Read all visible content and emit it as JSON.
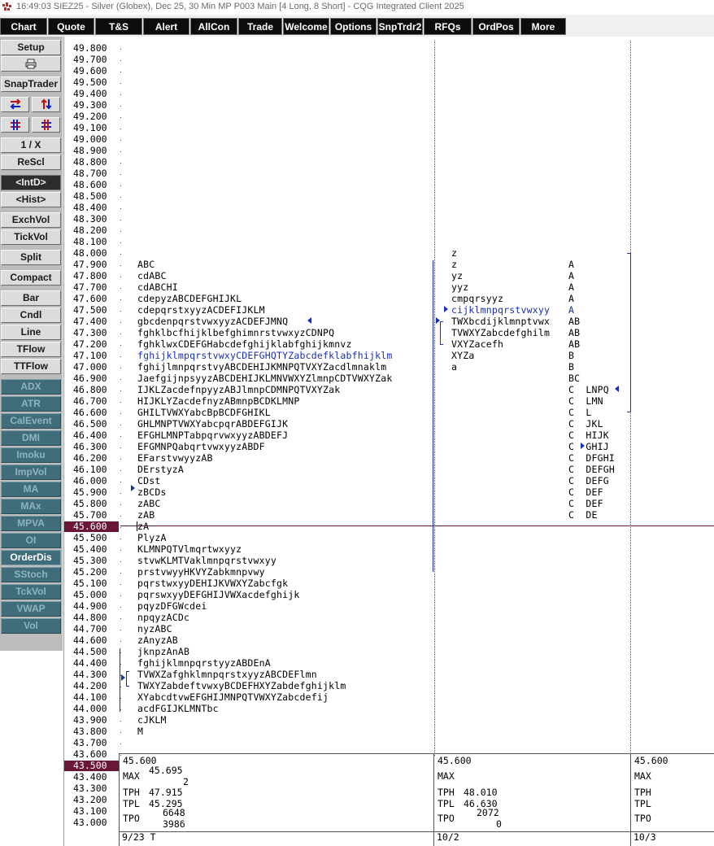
{
  "window": {
    "title": "16:49:03   SIEZ25 - Silver (Globex), Dec 25, 30 Min MP   P003 Main   [4 Long, 8 Short] - CQG Integrated Client 2025"
  },
  "menu": [
    "Chart",
    "Quote",
    "T&S",
    "Alert",
    "AllCon",
    "Trade",
    "Welcome",
    "Options",
    "SnpTrdr2",
    "RFQs",
    "OrdPos",
    "More"
  ],
  "sidebar": {
    "setup": "Setup",
    "print_icon": "printer-icon",
    "snaptrader": "SnapTrader",
    "one_x": "1 / X",
    "rescl": "ReScl",
    "intd": "<IntD>",
    "hist": "<Hist>",
    "exchvol": "ExchVol",
    "tickvol": "TickVol",
    "split": "Split",
    "compact": "Compact",
    "bar": "Bar",
    "cndl": "Cndl",
    "line": "Line",
    "tflow": "TFlow",
    "ttflow": "TTFlow",
    "studies": [
      "ADX",
      "ATR",
      "CalEvent",
      "DMI",
      "Imoku",
      "ImpVol",
      "MA",
      "MAx",
      "MPVA",
      "OI",
      "OrderDis",
      "SStoch",
      "TckVol",
      "VWAP",
      "Vol"
    ],
    "active_study": "OrderDis"
  },
  "price_axis": {
    "labels": [
      "49.800",
      "49.700",
      "49.600",
      "49.500",
      "49.400",
      "49.300",
      "49.200",
      "49.100",
      "49.000",
      "48.900",
      "48.800",
      "48.700",
      "48.600",
      "48.500",
      "48.400",
      "48.300",
      "48.200",
      "48.100",
      "48.000",
      "47.900",
      "47.800",
      "47.700",
      "47.600",
      "47.500",
      "47.400",
      "47.300",
      "47.200",
      "47.100",
      "47.000",
      "46.900",
      "46.800",
      "46.700",
      "46.600",
      "46.500",
      "46.400",
      "46.300",
      "46.200",
      "46.100",
      "46.000",
      "45.900",
      "45.800",
      "45.700",
      "45.600",
      "45.500",
      "45.400",
      "45.300",
      "45.200",
      "45.100",
      "45.000",
      "44.900",
      "44.800",
      "44.700",
      "44.600",
      "44.500",
      "44.400",
      "44.300",
      "44.200",
      "44.100",
      "44.000",
      "43.900",
      "43.800",
      "43.700",
      "43.600",
      "43.500",
      "43.400",
      "43.300",
      "43.200",
      "43.100",
      "43.000"
    ],
    "current_price": "45.600",
    "highlight_bottom": "43.500",
    "highlight_color": "#6b1537"
  },
  "profile1": {
    "rows": [
      {
        "price": "47.900",
        "text": "ABC"
      },
      {
        "price": "47.800",
        "text": "cdABC"
      },
      {
        "price": "47.700",
        "text": "cdABCHI"
      },
      {
        "price": "47.600",
        "text": "cdepyzABCDEFGHIJKL"
      },
      {
        "price": "47.500",
        "text": "cdepqrstxyyzACDEFIJKLM"
      },
      {
        "price": "47.400",
        "text": "gbcdenpqrstvwxyyzACDEFJMNQ"
      },
      {
        "price": "47.300",
        "text": "fghklbcfhijklbefghimnrstvwxyzCDNPQ"
      },
      {
        "price": "47.200",
        "text": "fghklwxCDEFGHabcdefghijklabfghijkmnvz"
      },
      {
        "price": "47.100",
        "text": "fghijklmpqrstvwxyCDEFGHQTYZabcdefklabfhijklm",
        "blue": true
      },
      {
        "price": "47.000",
        "text": "fghijlmnpqrstvyABCDEHIJKMNPQTVXYZacdlmnaklm"
      },
      {
        "price": "46.900",
        "text": "JaefgijnpsyyzABCDEHIJKLMNVWXYZlmnpCDTVWXYZak"
      },
      {
        "price": "46.800",
        "text": "IJKLZacdefnpyyzABJlmnpCDMNPQTVXYZak"
      },
      {
        "price": "46.700",
        "text": "HIJKLYZacdefnyzABmnpBCDKLMNP"
      },
      {
        "price": "46.600",
        "text": "GHILTVWXYabcBpBCDFGHIKL"
      },
      {
        "price": "46.500",
        "text": "GHLMNPTVWXYabcpqrABDEFGIJK"
      },
      {
        "price": "46.400",
        "text": "EFGHLMNPTabpqrvwxyyzABDEFJ"
      },
      {
        "price": "46.300",
        "text": "EFGMNPQabqrtvwxyyzABDF"
      },
      {
        "price": "46.200",
        "text": "EFarstvwyyzAB"
      },
      {
        "price": "46.100",
        "text": "DErstyzA"
      },
      {
        "price": "46.000",
        "text": "CDst"
      },
      {
        "price": "45.900",
        "text": "zBCDs"
      },
      {
        "price": "45.800",
        "text": "zABC"
      },
      {
        "price": "45.700",
        "text": "zAB"
      },
      {
        "price": "45.600",
        "text": "zA"
      },
      {
        "price": "45.500",
        "text": "PlyzA"
      },
      {
        "price": "45.400",
        "text": "KLMNPQTVlmqrtwxyyz"
      },
      {
        "price": "45.300",
        "text": "stvwKLMTVaklmnpqrstvwxyy"
      },
      {
        "price": "45.200",
        "text": "prstvwyyHKVYZabkmnpvwy"
      },
      {
        "price": "45.100",
        "text": "pqrstwxyyDEHIJKVWXYZabcfgk"
      },
      {
        "price": "45.000",
        "text": "pqrswxyyDEFGHIJVWXacdefghijk"
      },
      {
        "price": "44.900",
        "text": "pqyzDFGWcdei"
      },
      {
        "price": "44.800",
        "text": "npqyzACDc"
      },
      {
        "price": "44.700",
        "text": "nyzABC"
      },
      {
        "price": "44.600",
        "text": "zAnyzAB"
      },
      {
        "price": "44.500",
        "text": "jknpzAnAB"
      },
      {
        "price": "44.400",
        "text": "fghijklmnpqrstyyzABDEnA"
      },
      {
        "price": "44.300",
        "text": "TVWXZafghklmnpqrstxyyzABCDEFlmn"
      },
      {
        "price": "44.200",
        "text": "TWXYZabdeftvwxyBCDEFHXYZabdefghijklm"
      },
      {
        "price": "44.100",
        "text": "XYabcdtvwEFGHIJMNPQTVWXYZabcdefij"
      },
      {
        "price": "44.000",
        "text": "acdFGIJKLMNTbc"
      },
      {
        "price": "43.900",
        "text": "cJKLM"
      },
      {
        "price": "43.800",
        "text": "M"
      }
    ],
    "stats": {
      "price": "45.600",
      "max_label": "MAX",
      "max_val": "45.695",
      "max_count": "2",
      "tph_label": "TPH",
      "tph": "47.915",
      "tpl_label": "TPL",
      "tpl": "45.295",
      "tpo_label": "TPO",
      "tpo1": "6648",
      "tpo2": "3986"
    },
    "date": "9/23 T"
  },
  "profile2": {
    "rows": [
      {
        "price": "48.000",
        "text": "z"
      },
      {
        "price": "47.900",
        "text": "z"
      },
      {
        "price": "47.800",
        "text": "yz"
      },
      {
        "price": "47.700",
        "text": "yyz"
      },
      {
        "price": "47.600",
        "text": "cmpqrsyyz"
      },
      {
        "price": "47.500",
        "text": "cijklmnpqrstvwxyy",
        "blue": true
      },
      {
        "price": "47.400",
        "text": "TWXbcdijklmnptvwx"
      },
      {
        "price": "47.300",
        "text": "TVWXYZabcdefghilm"
      },
      {
        "price": "47.200",
        "text": "VXYZacefh"
      },
      {
        "price": "47.100",
        "text": "XYZa"
      },
      {
        "price": "47.000",
        "text": "a"
      }
    ],
    "stats": {
      "price": "45.600",
      "max_label": "MAX",
      "tph_label": "TPH",
      "tph": "48.010",
      "tpl_label": "TPL",
      "tpl": "46.630",
      "tpo_label": "TPO",
      "tpo1": "2072",
      "tpo2": "0"
    },
    "date": "10/2"
  },
  "profile3": {
    "rows": [
      {
        "price": "47.900",
        "text": "A"
      },
      {
        "price": "47.800",
        "text": "A"
      },
      {
        "price": "47.700",
        "text": "A"
      },
      {
        "price": "47.600",
        "text": "A"
      },
      {
        "price": "47.500",
        "text": "A",
        "blue": true
      },
      {
        "price": "47.400",
        "text": "AB"
      },
      {
        "price": "47.300",
        "text": "AB"
      },
      {
        "price": "47.200",
        "text": "AB"
      },
      {
        "price": "47.100",
        "text": "B"
      },
      {
        "price": "47.000",
        "text": "B"
      },
      {
        "price": "46.900",
        "text": "BC"
      },
      {
        "price": "46.800",
        "text": "C  LNPQ"
      },
      {
        "price": "46.700",
        "text": "C  LMN"
      },
      {
        "price": "46.600",
        "text": "C  L"
      },
      {
        "price": "46.500",
        "text": "C  JKL"
      },
      {
        "price": "46.400",
        "text": "C  HIJK"
      },
      {
        "price": "46.300",
        "text": "C  GHIJ"
      },
      {
        "price": "46.200",
        "text": "C  DFGHI"
      },
      {
        "price": "46.100",
        "text": "C  DEFGH"
      },
      {
        "price": "46.000",
        "text": "C  DEFG"
      },
      {
        "price": "45.900",
        "text": "C  DEF"
      },
      {
        "price": "45.800",
        "text": "C  DEF"
      },
      {
        "price": "45.700",
        "text": "C  DE"
      }
    ],
    "stats": {
      "price": "45.600",
      "max_label": "MAX",
      "tph_label": "TPH",
      "tpl_label": "TPL",
      "tpo_label": "TPO"
    },
    "date": "10/3"
  }
}
